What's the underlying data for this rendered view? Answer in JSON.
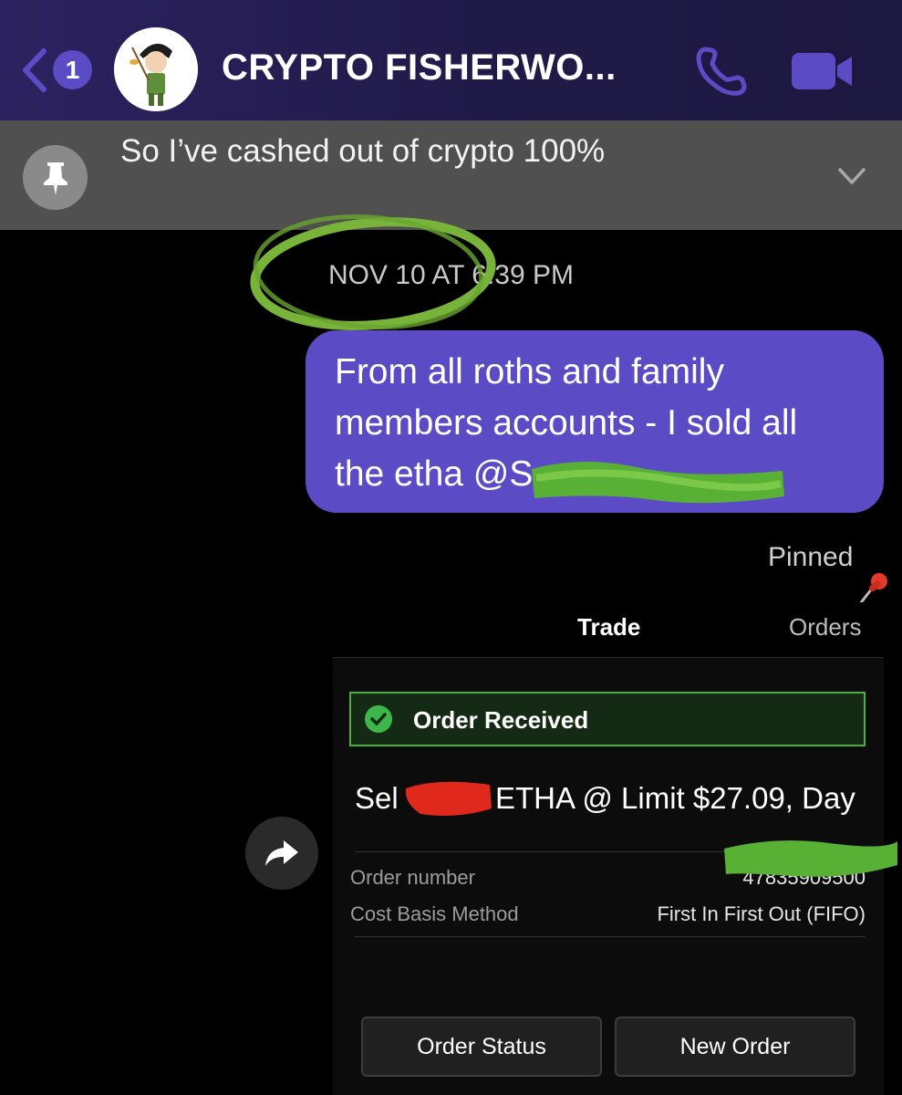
{
  "header": {
    "back_count": "1",
    "title": "CRYPTO FISHERWO...",
    "accent_color": "#5b4bc4",
    "icons": [
      "chevron-left-icon",
      "phone-icon",
      "video-camera-icon"
    ]
  },
  "pinned_banner": {
    "text": "So I’ve cashed out of crypto 100%",
    "icons": [
      "pin-icon",
      "chevron-down-icon"
    ]
  },
  "timestamp": "NOV 10 AT 6:39 PM",
  "message": {
    "line1": "From all roths and family",
    "line2": "members accounts - I sold all",
    "line3": "the etha @S",
    "bubble_color": "#5b4bc4"
  },
  "pinned_label": "Pinned",
  "attachment": {
    "tabs": {
      "trade": "Trade",
      "orders": "Orders"
    },
    "order_received": "Order Received",
    "sell_prefix": "Sel",
    "sell_suffix": "ETHA @ Limit $27.09, Day",
    "order_number_label": "Order number",
    "order_number_value": "47835909500",
    "cost_basis_label": "Cost Basis Method",
    "cost_basis_value": "First In First Out (FIFO)",
    "buttons": {
      "order_status": "Order Status",
      "new_order": "New Order"
    },
    "status_color": "#4fae45"
  }
}
